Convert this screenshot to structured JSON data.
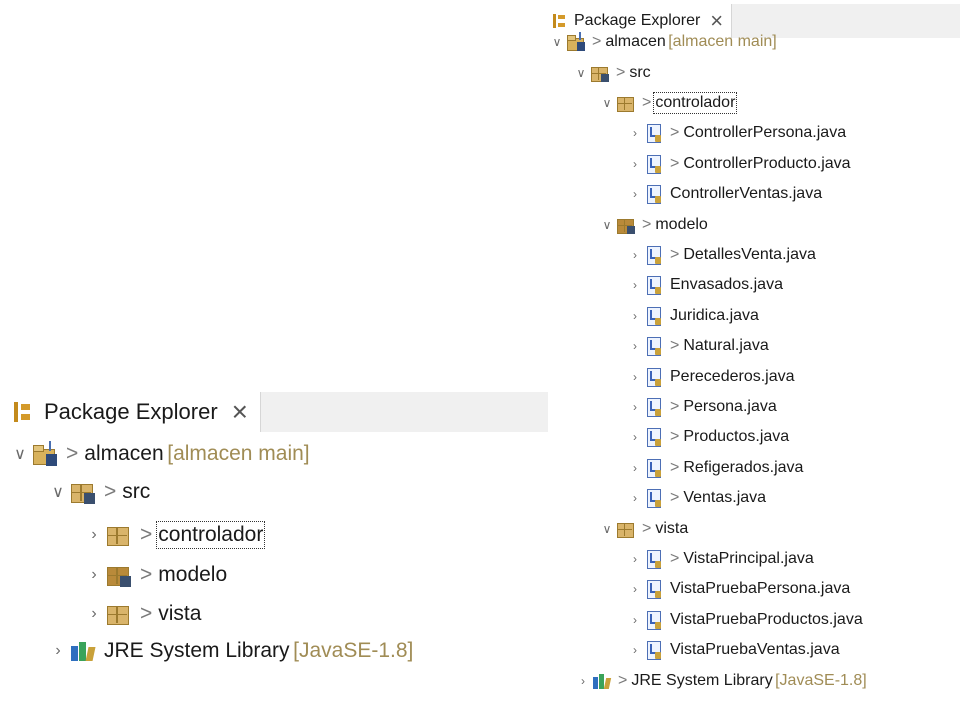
{
  "tab": {
    "title": "Package Explorer",
    "close": "×"
  },
  "project": {
    "name": "almacen",
    "repo": "[almacen main]"
  },
  "src": "src",
  "packages": {
    "controlador": "controlador",
    "modelo": "modelo",
    "vista": "vista"
  },
  "jre": {
    "name": "JRE System Library",
    "version": "[JavaSE-1.8]"
  },
  "controlador_files": [
    {
      "name": "ControllerPersona.java",
      "changed": true
    },
    {
      "name": "ControllerProducto.java",
      "changed": true
    },
    {
      "name": "ControllerVentas.java",
      "changed": false
    }
  ],
  "modelo_files": [
    {
      "name": "DetallesVenta.java",
      "changed": true
    },
    {
      "name": "Envasados.java",
      "changed": false
    },
    {
      "name": "Juridica.java",
      "changed": false
    },
    {
      "name": "Natural.java",
      "changed": true
    },
    {
      "name": "Perecederos.java",
      "changed": false
    },
    {
      "name": "Persona.java",
      "changed": true
    },
    {
      "name": "Productos.java",
      "changed": true
    },
    {
      "name": "Refigerados.java",
      "changed": true
    },
    {
      "name": "Ventas.java",
      "changed": true
    }
  ],
  "vista_files": [
    {
      "name": "VistaPrincipal.java",
      "changed": true
    },
    {
      "name": "VistaPruebaPersona.java",
      "changed": false
    },
    {
      "name": "VistaPruebaProductos.java",
      "changed": false
    },
    {
      "name": "VistaPruebaVentas.java",
      "changed": false
    }
  ],
  "glyphs": {
    "expanded": "∨",
    "collapsed": "›",
    "dirty": ">"
  }
}
